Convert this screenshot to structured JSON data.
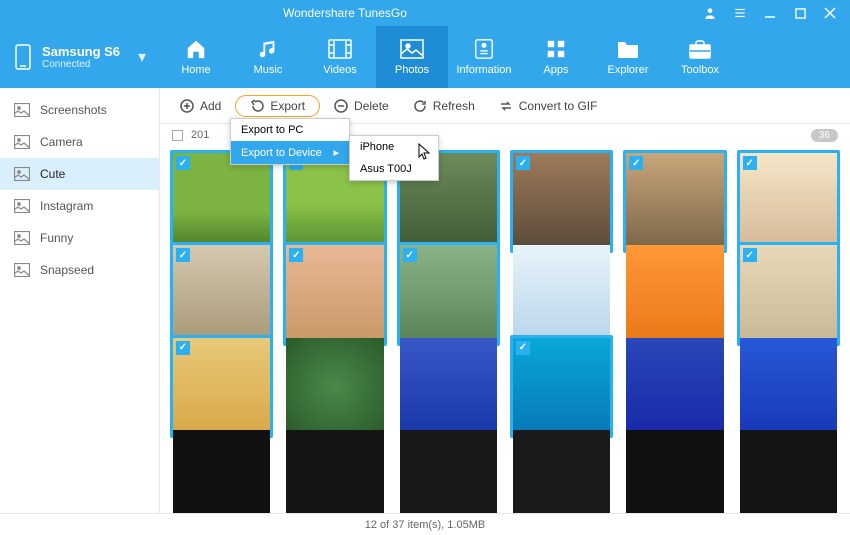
{
  "app": {
    "title": "Wondershare TunesGo"
  },
  "device": {
    "name": "Samsung S6",
    "status": "Connected"
  },
  "nav": [
    {
      "key": "home",
      "label": "Home"
    },
    {
      "key": "music",
      "label": "Music"
    },
    {
      "key": "videos",
      "label": "Videos"
    },
    {
      "key": "photos",
      "label": "Photos"
    },
    {
      "key": "information",
      "label": "Information"
    },
    {
      "key": "apps",
      "label": "Apps"
    },
    {
      "key": "explorer",
      "label": "Explorer"
    },
    {
      "key": "toolbox",
      "label": "Toolbox"
    }
  ],
  "nav_active": "photos",
  "sidebar": {
    "items": [
      {
        "label": "Screenshots"
      },
      {
        "label": "Camera"
      },
      {
        "label": "Cute"
      },
      {
        "label": "Instagram"
      },
      {
        "label": "Funny"
      },
      {
        "label": "Snapseed"
      }
    ],
    "active_index": 2
  },
  "toolbar": {
    "add": "Add",
    "export": "Export",
    "delete": "Delete",
    "refresh": "Refresh",
    "gif": "Convert to GIF"
  },
  "export_menu": {
    "pc": "Export to PC",
    "device": "Export to Device",
    "targets": [
      "iPhone",
      "Asus T00J"
    ]
  },
  "group": {
    "date_prefix": "201",
    "count": "36"
  },
  "thumbs": [
    {
      "sel": true,
      "bg": "bg1"
    },
    {
      "sel": true,
      "bg": "bg2"
    },
    {
      "sel": true,
      "bg": "bg3"
    },
    {
      "sel": true,
      "bg": "bg4"
    },
    {
      "sel": true,
      "bg": "bg5"
    },
    {
      "sel": true,
      "bg": "bg6"
    },
    {
      "sel": true,
      "bg": "bg7"
    },
    {
      "sel": true,
      "bg": "bg8"
    },
    {
      "sel": true,
      "bg": "bg9"
    },
    {
      "sel": false,
      "bg": "bg10"
    },
    {
      "sel": false,
      "bg": "bg11"
    },
    {
      "sel": true,
      "bg": "bg12"
    },
    {
      "sel": true,
      "bg": "bg13"
    },
    {
      "sel": false,
      "bg": "bg14"
    },
    {
      "sel": false,
      "bg": "bg15"
    },
    {
      "sel": true,
      "bg": "bg16"
    },
    {
      "sel": false,
      "bg": "bg17"
    },
    {
      "sel": false,
      "bg": "bg18"
    },
    {
      "sel": false,
      "bg": "bg19"
    },
    {
      "sel": false,
      "bg": "bg20"
    },
    {
      "sel": false,
      "bg": "bg21"
    },
    {
      "sel": false,
      "bg": "bg22"
    },
    {
      "sel": false,
      "bg": "bg23"
    },
    {
      "sel": false,
      "bg": "bg24"
    }
  ],
  "status": "12 of 37 item(s), 1.05MB"
}
